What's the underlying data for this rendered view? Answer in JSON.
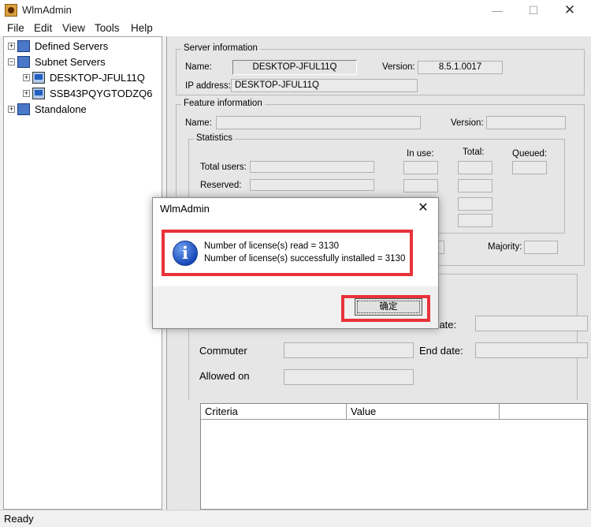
{
  "window": {
    "title": "WlmAdmin"
  },
  "menu": [
    "File",
    "Edit",
    "View",
    "Tools",
    "Help"
  ],
  "tree": {
    "defined_servers": "Defined Servers",
    "subnet_servers": "Subnet Servers",
    "children": [
      "DESKTOP-JFUL11Q",
      "SSB43PQYGTODZQ6"
    ],
    "standalone": "Standalone"
  },
  "server_info": {
    "legend": "Server information",
    "name_label": "Name:",
    "name_value": "DESKTOP-JFUL11Q",
    "version_label": "Version:",
    "version_value": "8.5.1.0017",
    "ip_label": "IP address:",
    "ip_value": "DESKTOP-JFUL11Q"
  },
  "feature_info": {
    "legend": "Feature information",
    "name_label": "Name:",
    "version_label": "Version:"
  },
  "statistics": {
    "legend": "Statistics",
    "in_use": "In use:",
    "total": "Total:",
    "queued": "Queued:",
    "total_users": "Total users:",
    "reserved": "Reserved:",
    "majority": "Majority:"
  },
  "lower": {
    "start_date_partial": "t date:",
    "commuter": "Commuter",
    "end_date": "End date:",
    "allowed_on": "Allowed on"
  },
  "table": {
    "columns": [
      "Criteria",
      "Value"
    ]
  },
  "status": "Ready",
  "dialog": {
    "title": "WlmAdmin",
    "line1": "Number of license(s) read = 3130",
    "line2": "Number of license(s) successfully installed = 3130",
    "ok": "确定"
  },
  "colors": {
    "highlight": "#e8323a",
    "info_icon": "#1a4ab8"
  },
  "icons": [
    "app-icon",
    "expand-icon",
    "network-icon",
    "computer-icon",
    "info-icon",
    "close-icon",
    "minimize-icon",
    "maximize-icon"
  ]
}
